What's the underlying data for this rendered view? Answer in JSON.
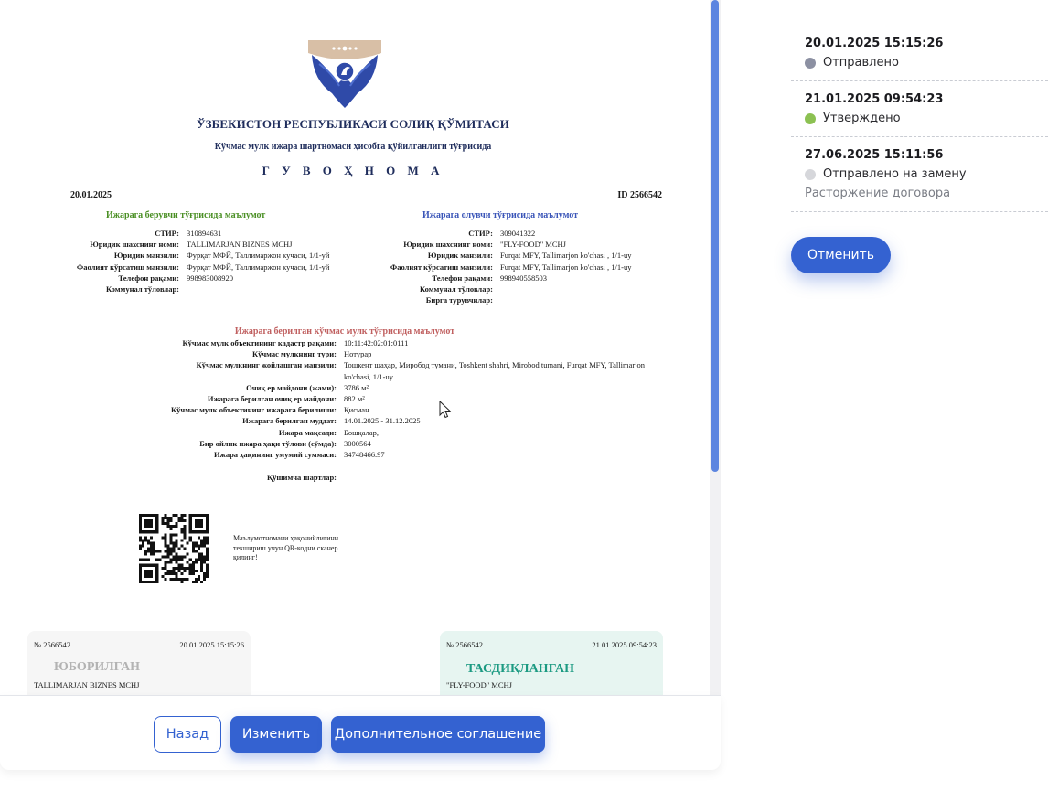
{
  "document": {
    "agency_title": "ЎЗБЕКИСТОН РЕСПУБЛИКАСИ СОЛИҚ ҚЎМИТАСИ",
    "subtitle": "Кўчмас мулк ижара шартномаси ҳисобга қўйилганлиги тўғрисида",
    "doc_title": "Г У В О Ҳ Н О М А",
    "date": "20.01.2025",
    "id": "ID 2566542",
    "lessor": {
      "heading": "Ижарага берувчи тўғрисида маълумот",
      "rows": [
        {
          "k": "СТИР:",
          "v": "310894631"
        },
        {
          "k": "Юридик шахснинг номи:",
          "v": "TALLIMARJAN BIZNES MCHJ"
        },
        {
          "k": "Юридик манзили:",
          "v": "Фурқат МФЙ, Таллимаржон кучаси, 1/1-уй"
        },
        {
          "k": "Фаолият кўрсатиш манзили:",
          "v": "Фурқат МФЙ, Таллимаржон кучаси, 1/1-уй"
        },
        {
          "k": "Телефон рақами:",
          "v": "998983008920"
        },
        {
          "k": "Коммунал тўловлар:",
          "v": ""
        }
      ]
    },
    "lessee": {
      "heading": "Ижарага олувчи тўғрисида маълумот",
      "rows": [
        {
          "k": "СТИР:",
          "v": "309041322"
        },
        {
          "k": "Юридик шахснинг номи:",
          "v": "\"FLY-FOOD\" MCHJ"
        },
        {
          "k": "Юридик манзили:",
          "v": "Furqat MFY, Tallimarjon ko'chasi , 1/1-uy"
        },
        {
          "k": "Фаолият кўрсатиш манзили:",
          "v": "Furqat MFY, Tallimarjon ko'chasi , 1/1-uy"
        },
        {
          "k": "Телефон рақами:",
          "v": "998940558503"
        },
        {
          "k": "Коммунал тўловлар:",
          "v": ""
        },
        {
          "k": "Бирга турувчилар:",
          "v": ""
        }
      ]
    },
    "property": {
      "heading": "Ижарага берилган кўчмас мулк тўғрисида маълумот",
      "rows": [
        {
          "k": "Кўчмас мулк объектининг кадастр рақами:",
          "v": "10:11:42:02:01:0111"
        },
        {
          "k": "Кўчмас мулкнинг тури:",
          "v": "Нотурар"
        },
        {
          "k": "Кўчмас мулкнинг жойлашган манзили:",
          "v": "Тошкент шаҳар, Миробод тумани, Toshkent shahri, Mirobod tumani, Furqat MFY, Tallimarjon ko'chasi, 1/1-uy"
        },
        {
          "k": "Очиқ ер майдони (жами):",
          "v": "3786 м²"
        },
        {
          "k": "Ижарага берилган очиқ ер майдони:",
          "v": "882 м²"
        },
        {
          "k": "Кўчмас мулк объектининг ижарага берилиши:",
          "v": "Қисман"
        },
        {
          "k": "Ижарага берилган муддат:",
          "v": "14.01.2025 - 31.12.2025"
        },
        {
          "k": "Ижара мақсади:",
          "v": "Бошқалар,"
        },
        {
          "k": "Бир ойлик ижара ҳақи тўлови (сўмда):",
          "v": "3000564"
        },
        {
          "k": "Ижара ҳақининг умумий суммаси:",
          "v": "34748466.97"
        }
      ],
      "extra_label": "Қўшимча шартлар:"
    },
    "qr_caption": "Маълумотномани ҳақонийлигини текшириш учун QR-кодни сканер қилинг!",
    "cards": {
      "sent": {
        "number": "№ 2566542",
        "datetime": "20.01.2025 15:15:26",
        "status": "ЮБОРИЛГАН",
        "org": "TALLIMARJAN BIZNES MCHJ"
      },
      "approved": {
        "number": "№ 2566542",
        "datetime": "21.01.2025 09:54:23",
        "status": "ТАСДИҚЛАНГАН",
        "org": "\"FLY-FOOD\" MCHJ"
      }
    }
  },
  "actions": {
    "back": "Назад",
    "edit": "Изменить",
    "additional": "Дополнительное соглашение"
  },
  "history": [
    {
      "datetime": "20.01.2025 15:15:26",
      "status": "Отправлено",
      "color": "#8c90a2",
      "note": ""
    },
    {
      "datetime": "21.01.2025 09:54:23",
      "status": "Утверждено",
      "color": "#8cc152",
      "note": ""
    },
    {
      "datetime": "27.06.2025 15:11:56",
      "status": "Отправлено на замену",
      "color": "#d6d7db",
      "note": "Расторжение договора"
    }
  ],
  "cancel_label": "Отменить",
  "colors": {
    "accent": "#3462d1",
    "lessor_heading": "#4a8f24",
    "lessee_heading": "#3a55b8",
    "property_heading": "#c06060"
  }
}
